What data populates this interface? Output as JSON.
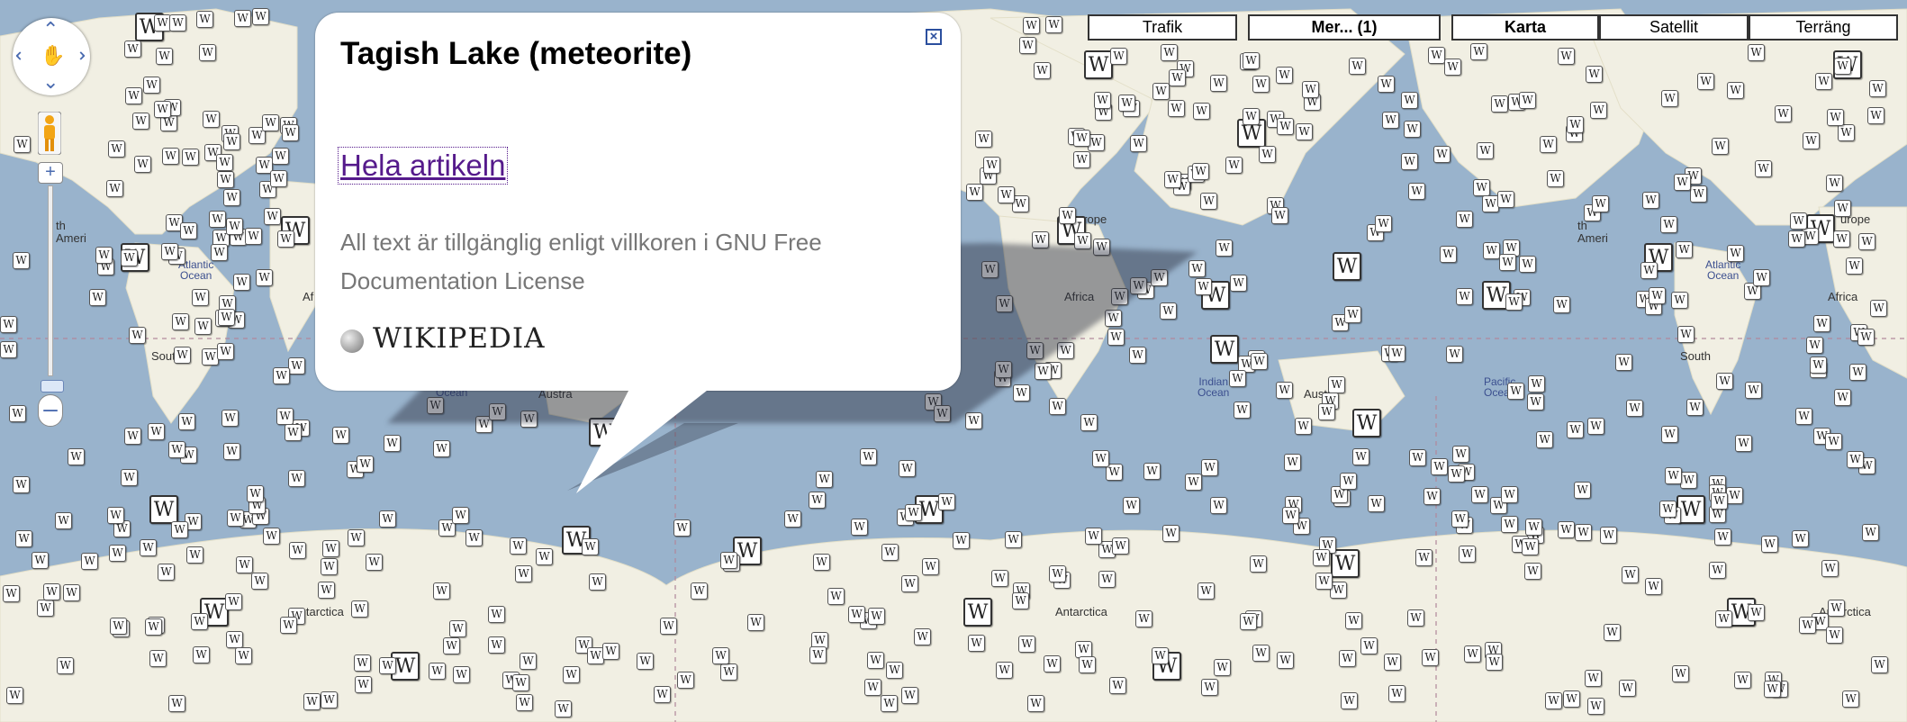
{
  "map_types": {
    "traffic": "Trafik",
    "more": "Mer... (1)",
    "map": "Karta",
    "satellite": "Satellit",
    "terrain": "Terräng",
    "active": "Karta"
  },
  "nav": {
    "zoom_in": "+",
    "zoom_out": "–"
  },
  "marker_glyph": "W",
  "places": {
    "antarctica_1": "Antarctica",
    "antarctica_2": "Antarctica",
    "antarctica_3": "Antarctica",
    "africa_1": "Af",
    "africa_2": "Africa",
    "africa_3": "Africa",
    "europe_2": "urope",
    "europe_3": "urope",
    "south_america_1": "South",
    "south_america_2": "South",
    "atlantic_1": "Atlantic\nOcean",
    "atlantic_3": "Atlantic\nOcean",
    "indian_2": "Indian\nOcean",
    "pacific_2": "Pacific\nOcean",
    "north_america_1": "th\nAmeri",
    "north_america_3": "th\nAmeri",
    "australia_1": "Austra",
    "australia_2": "Austra",
    "ocean_1": "Ocean"
  },
  "info_window": {
    "title": "Tagish Lake (meteorite)",
    "link": "Hela artikeln",
    "license": "All text är tillgänglig enligt villkoren i GNU Free Documentation License",
    "logo_text": "WIKIPEDIA",
    "close": "×"
  },
  "colors": {
    "ocean": "#99b3cc",
    "land": "#f1efe3",
    "visited_link": "#551a8b",
    "control_blue": "#4a6bb0"
  },
  "icons": [
    "close-icon",
    "pan-arrow-icons",
    "pegman-icon",
    "wikipedia-marker-icon",
    "wikipedia-globe-icon"
  ]
}
